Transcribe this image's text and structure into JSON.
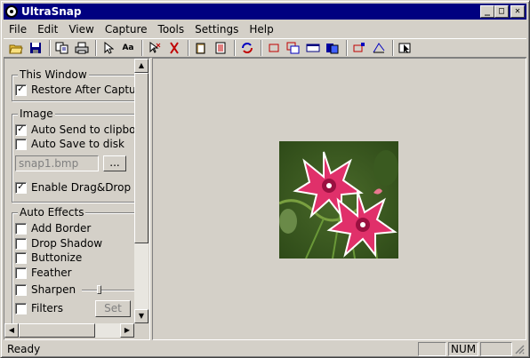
{
  "window": {
    "title": "UltraSnap"
  },
  "menu": [
    {
      "label": "File"
    },
    {
      "label": "Edit"
    },
    {
      "label": "View"
    },
    {
      "label": "Capture"
    },
    {
      "label": "Tools"
    },
    {
      "label": "Settings"
    },
    {
      "label": "Help"
    }
  ],
  "toolbar": {
    "icons": [
      "open-icon",
      "save-icon",
      "copy-icon",
      "print-icon",
      "select-arrow-icon",
      "text-aa-icon",
      "pick-icon",
      "crop-icon",
      "clipboard-icon",
      "paste-icon",
      "refresh-icon",
      "capture-rect-icon",
      "capture-multi-icon",
      "capture-window-icon",
      "capture-region-icon",
      "capture-object-icon",
      "capture-freehand-icon",
      "settings-icon"
    ]
  },
  "left_panel": {
    "this_window": {
      "label": "This Window",
      "restore": {
        "label": "Restore After Capture",
        "checked": true
      }
    },
    "image": {
      "label": "Image",
      "auto_send": {
        "label": "Auto Send to clipboard",
        "checked": true
      },
      "auto_save": {
        "label": "Auto Save to disk",
        "checked": false
      },
      "filename": "snap1.bmp",
      "browse_label": "...",
      "drag_drop": {
        "label": "Enable Drag&Drop",
        "checked": true
      }
    },
    "auto_effects": {
      "label": "Auto Effects",
      "add_border": {
        "label": "Add Border",
        "checked": false
      },
      "drop_shadow": {
        "label": "Drop Shadow",
        "checked": false
      },
      "buttonize": {
        "label": "Buttonize",
        "checked": false
      },
      "feather": {
        "label": "Feather",
        "checked": false
      },
      "sharpen": {
        "label": "Sharpen",
        "checked": false,
        "level": 0.3
      },
      "filters": {
        "label": "Filters",
        "checked": false
      },
      "set_label": "Set"
    }
  },
  "status": {
    "text": "Ready",
    "num": "NUM"
  },
  "colors": {
    "titlebar": "#000080",
    "face": "#d4d0c8",
    "flower": "#e0306a"
  }
}
